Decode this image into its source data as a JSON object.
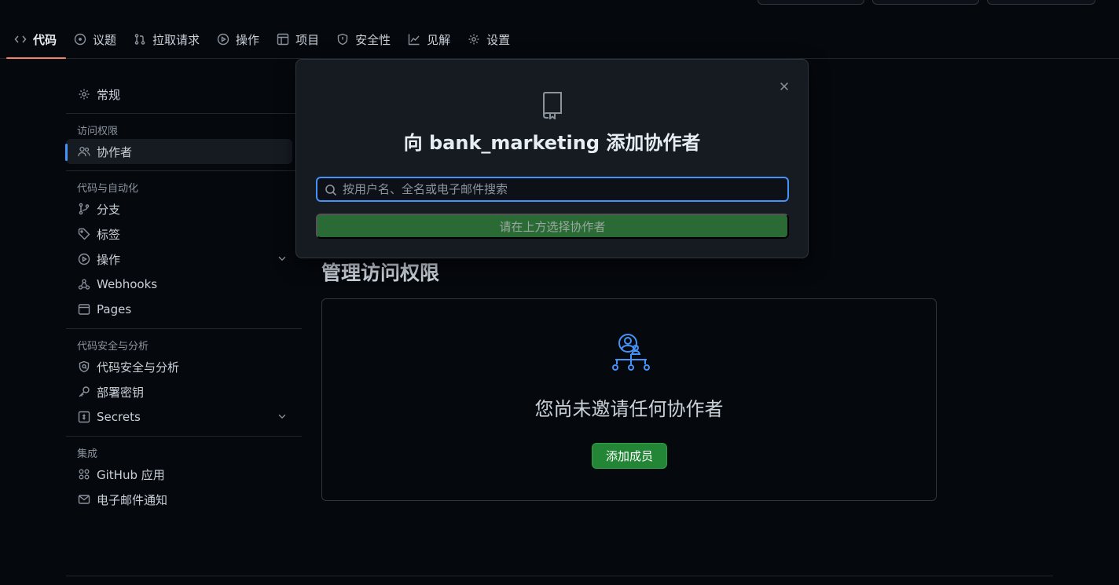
{
  "tabs": [
    {
      "label": "代码",
      "icon": "code-icon",
      "active": true
    },
    {
      "label": "议题",
      "icon": "issue-icon"
    },
    {
      "label": "拉取请求",
      "icon": "pull-request-icon"
    },
    {
      "label": "操作",
      "icon": "play-icon"
    },
    {
      "label": "项目",
      "icon": "table-icon"
    },
    {
      "label": "安全性",
      "icon": "shield-icon"
    },
    {
      "label": "见解",
      "icon": "graph-icon"
    },
    {
      "label": "设置",
      "icon": "gear-icon"
    }
  ],
  "sidebar": {
    "general": "常规",
    "access_heading": "访问权限",
    "collaborators": "协作者",
    "code_heading": "代码与自动化",
    "branches": "分支",
    "tags": "标签",
    "actions": "操作",
    "webhooks": "Webhooks",
    "pages": "Pages",
    "security_heading": "代码安全与分析",
    "code_security": "代码安全与分析",
    "deploy_keys": "部署密钥",
    "secrets": "Secrets",
    "integrations_heading": "集成",
    "github_apps": "GitHub 应用",
    "email_notifications": "电子邮件通知"
  },
  "main": {
    "title": "管理访问权限",
    "empty_text": "您尚未邀请任何协作者",
    "add_button": "添加成员"
  },
  "modal": {
    "title": "向 bank_marketing 添加协作者",
    "search_placeholder": "按用户名、全名或电子邮件搜索",
    "submit_label": "请在上方选择协作者"
  },
  "colors": {
    "accent_blue": "#4493f8",
    "green": "#238636",
    "tab_underline": "#f78166"
  }
}
